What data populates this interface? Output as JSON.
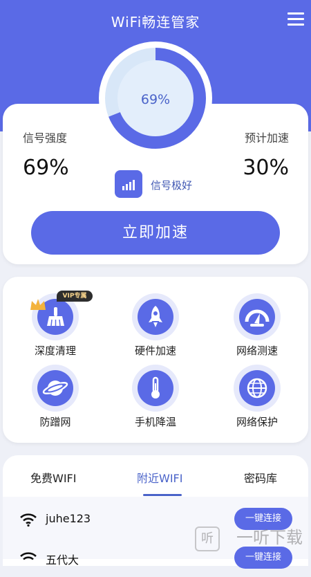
{
  "app": {
    "title": "WiFi畅连管家"
  },
  "gauge": {
    "value_text": "69%",
    "percent": 69
  },
  "stats": {
    "signal_label": "信号强度",
    "signal_value": "69%",
    "boost_label": "预计加速",
    "boost_value": "30%",
    "quality_text": "信号极好"
  },
  "actions": {
    "boost_button": "立即加速"
  },
  "tools": [
    {
      "label": "深度清理",
      "icon": "broom-icon",
      "badge": "VIP专属"
    },
    {
      "label": "硬件加速",
      "icon": "rocket-icon"
    },
    {
      "label": "网络测速",
      "icon": "speedometer-icon"
    },
    {
      "label": "防蹭网",
      "icon": "planet-icon"
    },
    {
      "label": "手机降温",
      "icon": "thermometer-icon"
    },
    {
      "label": "网络保护",
      "icon": "globe-icon"
    }
  ],
  "tabs": [
    {
      "label": "免费WIFI",
      "active": false
    },
    {
      "label": "附近WIFI",
      "active": true
    },
    {
      "label": "密码库",
      "active": false
    }
  ],
  "wifi_list": [
    {
      "name": "juhe123",
      "action": "一键连接"
    },
    {
      "name": "五代大",
      "action": "一键连接"
    }
  ],
  "watermark": {
    "text": "一听下载",
    "icon_char": "听"
  },
  "colors": {
    "primary": "#5a6ae6",
    "accent_text": "#4a63c9",
    "background": "#eef0f7"
  }
}
